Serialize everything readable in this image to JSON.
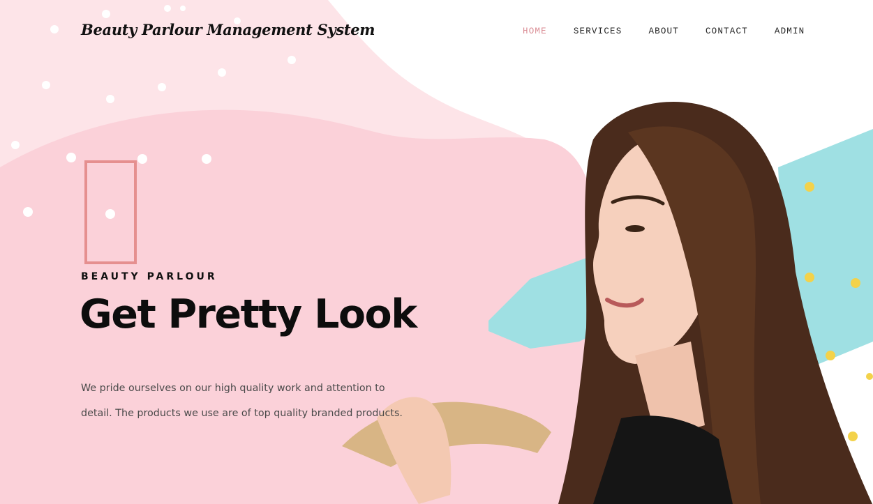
{
  "header": {
    "brand": "Beauty Parlour Management System",
    "nav": [
      {
        "label": "HOME",
        "active": true
      },
      {
        "label": "SERVICES",
        "active": false
      },
      {
        "label": "ABOUT",
        "active": false
      },
      {
        "label": "CONTACT",
        "active": false
      },
      {
        "label": "ADMIN",
        "active": false
      }
    ]
  },
  "hero": {
    "kicker": "BEAUTY PARLOUR",
    "headline": "Get Pretty Look",
    "description": "We pride ourselves on our high quality work and attention to detail. The products we use are of top quality branded products."
  },
  "colors": {
    "pink_light": "#fde4e8",
    "pink_main": "#fbd1d9",
    "frame": "#e58f8f",
    "teal": "#9fe0e3",
    "yellow_dot": "#f3d24a",
    "nav_active": "#d98a92"
  }
}
